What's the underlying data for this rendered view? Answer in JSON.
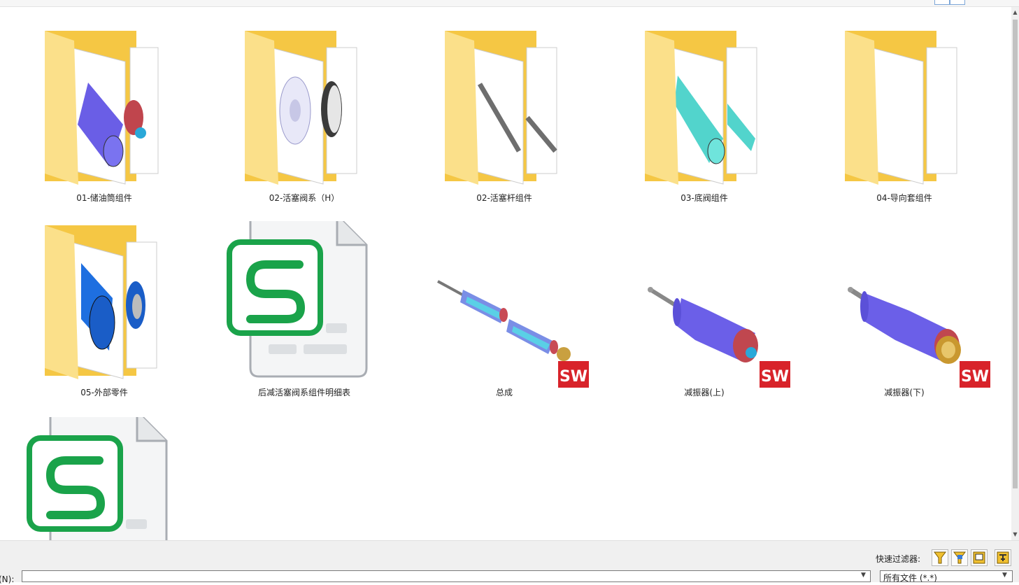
{
  "items": [
    {
      "label": "01-储油筒组件",
      "kind": "folder",
      "icon": "folder-icon"
    },
    {
      "label": "02-活塞阀系（H）",
      "kind": "folder",
      "icon": "folder-icon"
    },
    {
      "label": "02-活塞杆组件",
      "kind": "folder",
      "icon": "folder-icon"
    },
    {
      "label": "03-底阀组件",
      "kind": "folder",
      "icon": "folder-icon"
    },
    {
      "label": "04-导向套组件",
      "kind": "folder",
      "icon": "folder-icon"
    },
    {
      "label": "05-外部零件",
      "kind": "folder",
      "icon": "folder-icon"
    },
    {
      "label": "后减活塞阀系组件明细表",
      "kind": "spreadsheet",
      "icon": "spreadsheet-s-icon"
    },
    {
      "label": "总成",
      "kind": "solidworks",
      "icon": "solidworks-icon"
    },
    {
      "label": "减振器(上)",
      "kind": "solidworks",
      "icon": "solidworks-icon"
    },
    {
      "label": "减振器(下)",
      "kind": "solidworks",
      "icon": "solidworks-icon"
    },
    {
      "label": "",
      "kind": "spreadsheet",
      "icon": "spreadsheet-s-icon"
    }
  ],
  "sw_badge_text": "SW",
  "bottom": {
    "quick_filter_label": "快速过滤器:",
    "filename_label": "名(N):",
    "filename_value": "",
    "filetype_value": "所有文件 (*.*)"
  },
  "colors": {
    "folder": "#f7d774",
    "spreadsheet_green": "#1aa34a",
    "sw_red": "#d8232a"
  }
}
